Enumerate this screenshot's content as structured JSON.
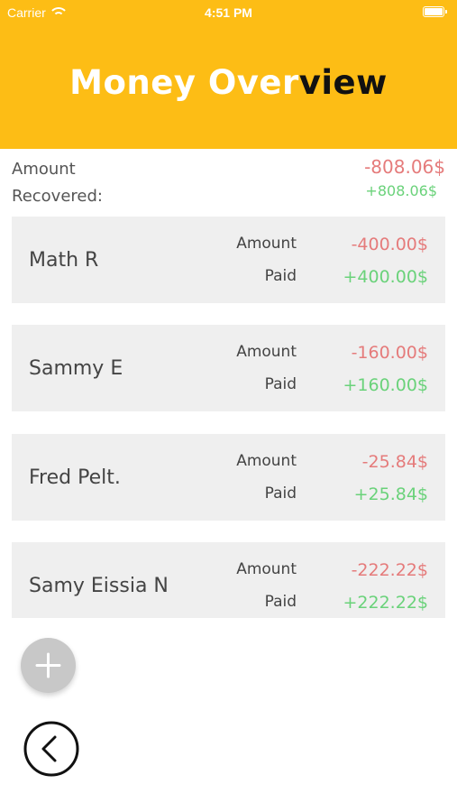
{
  "status_bar": {
    "carrier": "Carrier",
    "time": "4:51 PM"
  },
  "header": {
    "title_part1": "Money Over",
    "title_part2": "view",
    "background_color": "#fdbd15"
  },
  "summary": {
    "label": "Amount Recovered:",
    "amount": "-808.06$",
    "paid": "+808.06$"
  },
  "labels": {
    "amount": "Amount",
    "paid": "Paid"
  },
  "people": [
    {
      "name": "Math R",
      "amount": "-400.00$",
      "paid": "+400.00$"
    },
    {
      "name": "Sammy E",
      "amount": "-160.00$",
      "paid": "+160.00$"
    },
    {
      "name": "Fred Pelt.",
      "amount": "-25.84$",
      "paid": "+25.84$"
    },
    {
      "name": "Samy Eissia N",
      "amount": "-222.22$",
      "paid": "+222.22$"
    }
  ],
  "colors": {
    "negative": "#e57b7b",
    "positive": "#6ad27a"
  },
  "icons": {
    "add": "plus-icon",
    "back": "chevron-left-icon"
  }
}
